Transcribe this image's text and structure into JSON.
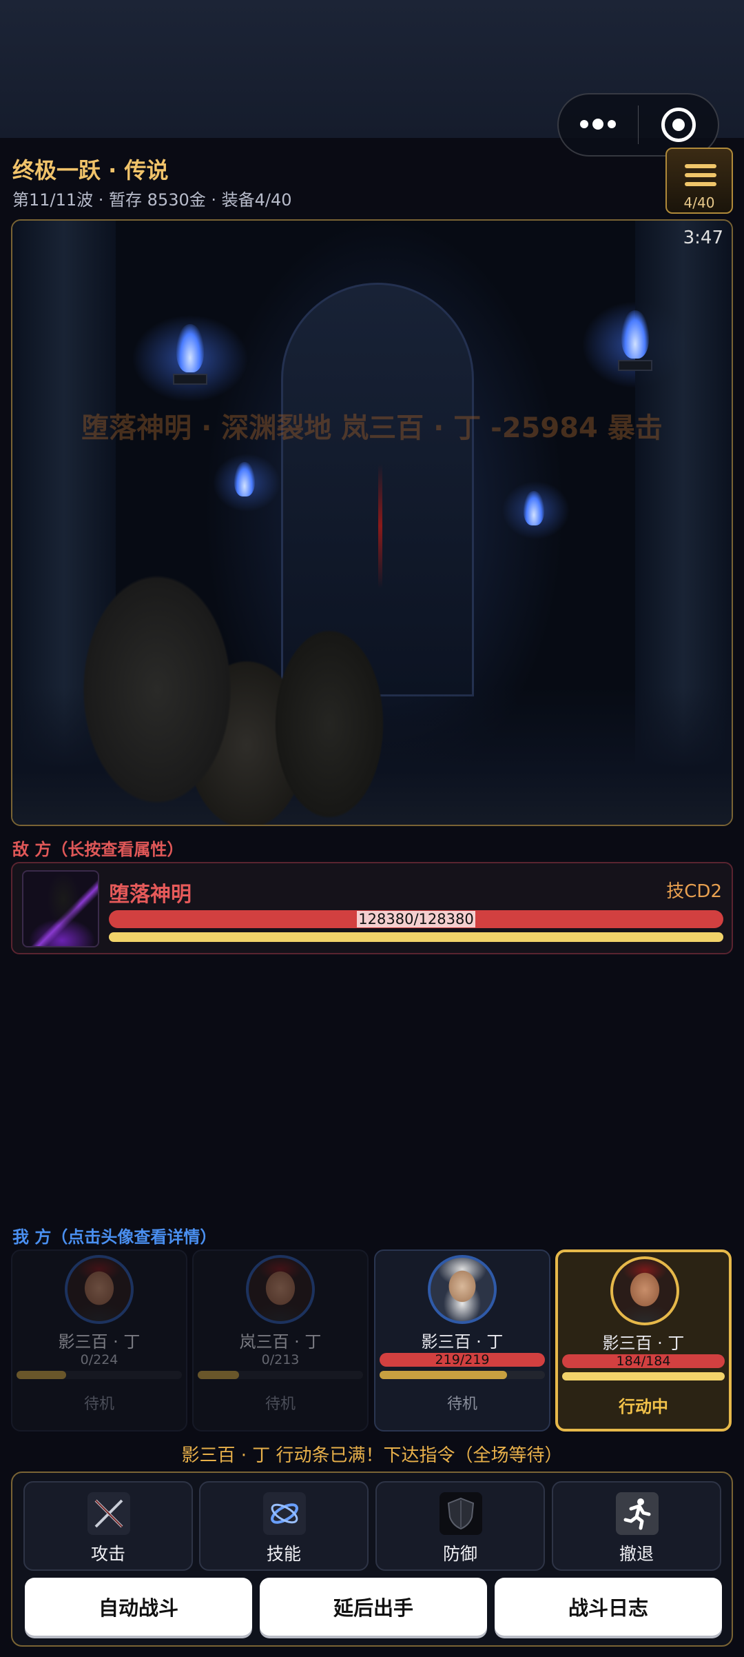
{
  "header": {
    "title": "终极一跃 · 传说",
    "subtitle": "第11/11波 · 暂存 8530金 · 装备4/40",
    "bag_count": "4/40"
  },
  "scene": {
    "timer": "3:47",
    "battle_text": "堕落神明 · 深渊裂地 岚三百 · 丁 -25984 暴击"
  },
  "enemy": {
    "section_label": "敌 方（长按查看属性）",
    "name": "堕落神明",
    "skill_cd": "技CD2",
    "hp_text": "128380/128380",
    "hp_fraction": 1.0,
    "action_fraction": 1.0
  },
  "team": {
    "section_label": "我 方（点击头像查看详情）",
    "heroes": [
      {
        "name": "影三百 · 丁",
        "hp": "0/224",
        "status": "待机",
        "action_fraction": 0.3
      },
      {
        "name": "岚三百 · 丁",
        "hp": "0/213",
        "status": "待机",
        "action_fraction": 0.25
      },
      {
        "name": "影三百 · 丁",
        "hp": "219/219",
        "status": "待机",
        "action_fraction": 0.77
      },
      {
        "name": "影三百 · 丁",
        "hp": "184/184",
        "status": "行动中",
        "action_fraction": 1.0
      }
    ]
  },
  "notice": "影三百 · 丁 行动条已满！下达指令（全场等待）",
  "commands": {
    "attack": {
      "label": "攻击",
      "icon": "crossed-swords-icon"
    },
    "skill": {
      "label": "技能",
      "icon": "magic-swirl-icon"
    },
    "defend": {
      "label": "防御",
      "icon": "shield-icon"
    },
    "retreat": {
      "label": "撤退",
      "icon": "running-man-icon"
    }
  },
  "actions": {
    "auto_battle": "自动战斗",
    "delay": "延后出手",
    "log": "战斗日志"
  },
  "colors": {
    "gold": "#f1c36a",
    "enemy_red": "#e05858",
    "team_blue": "#4a8ff0",
    "hp_red": "#d24040",
    "action_yellow": "#f2d36a"
  }
}
